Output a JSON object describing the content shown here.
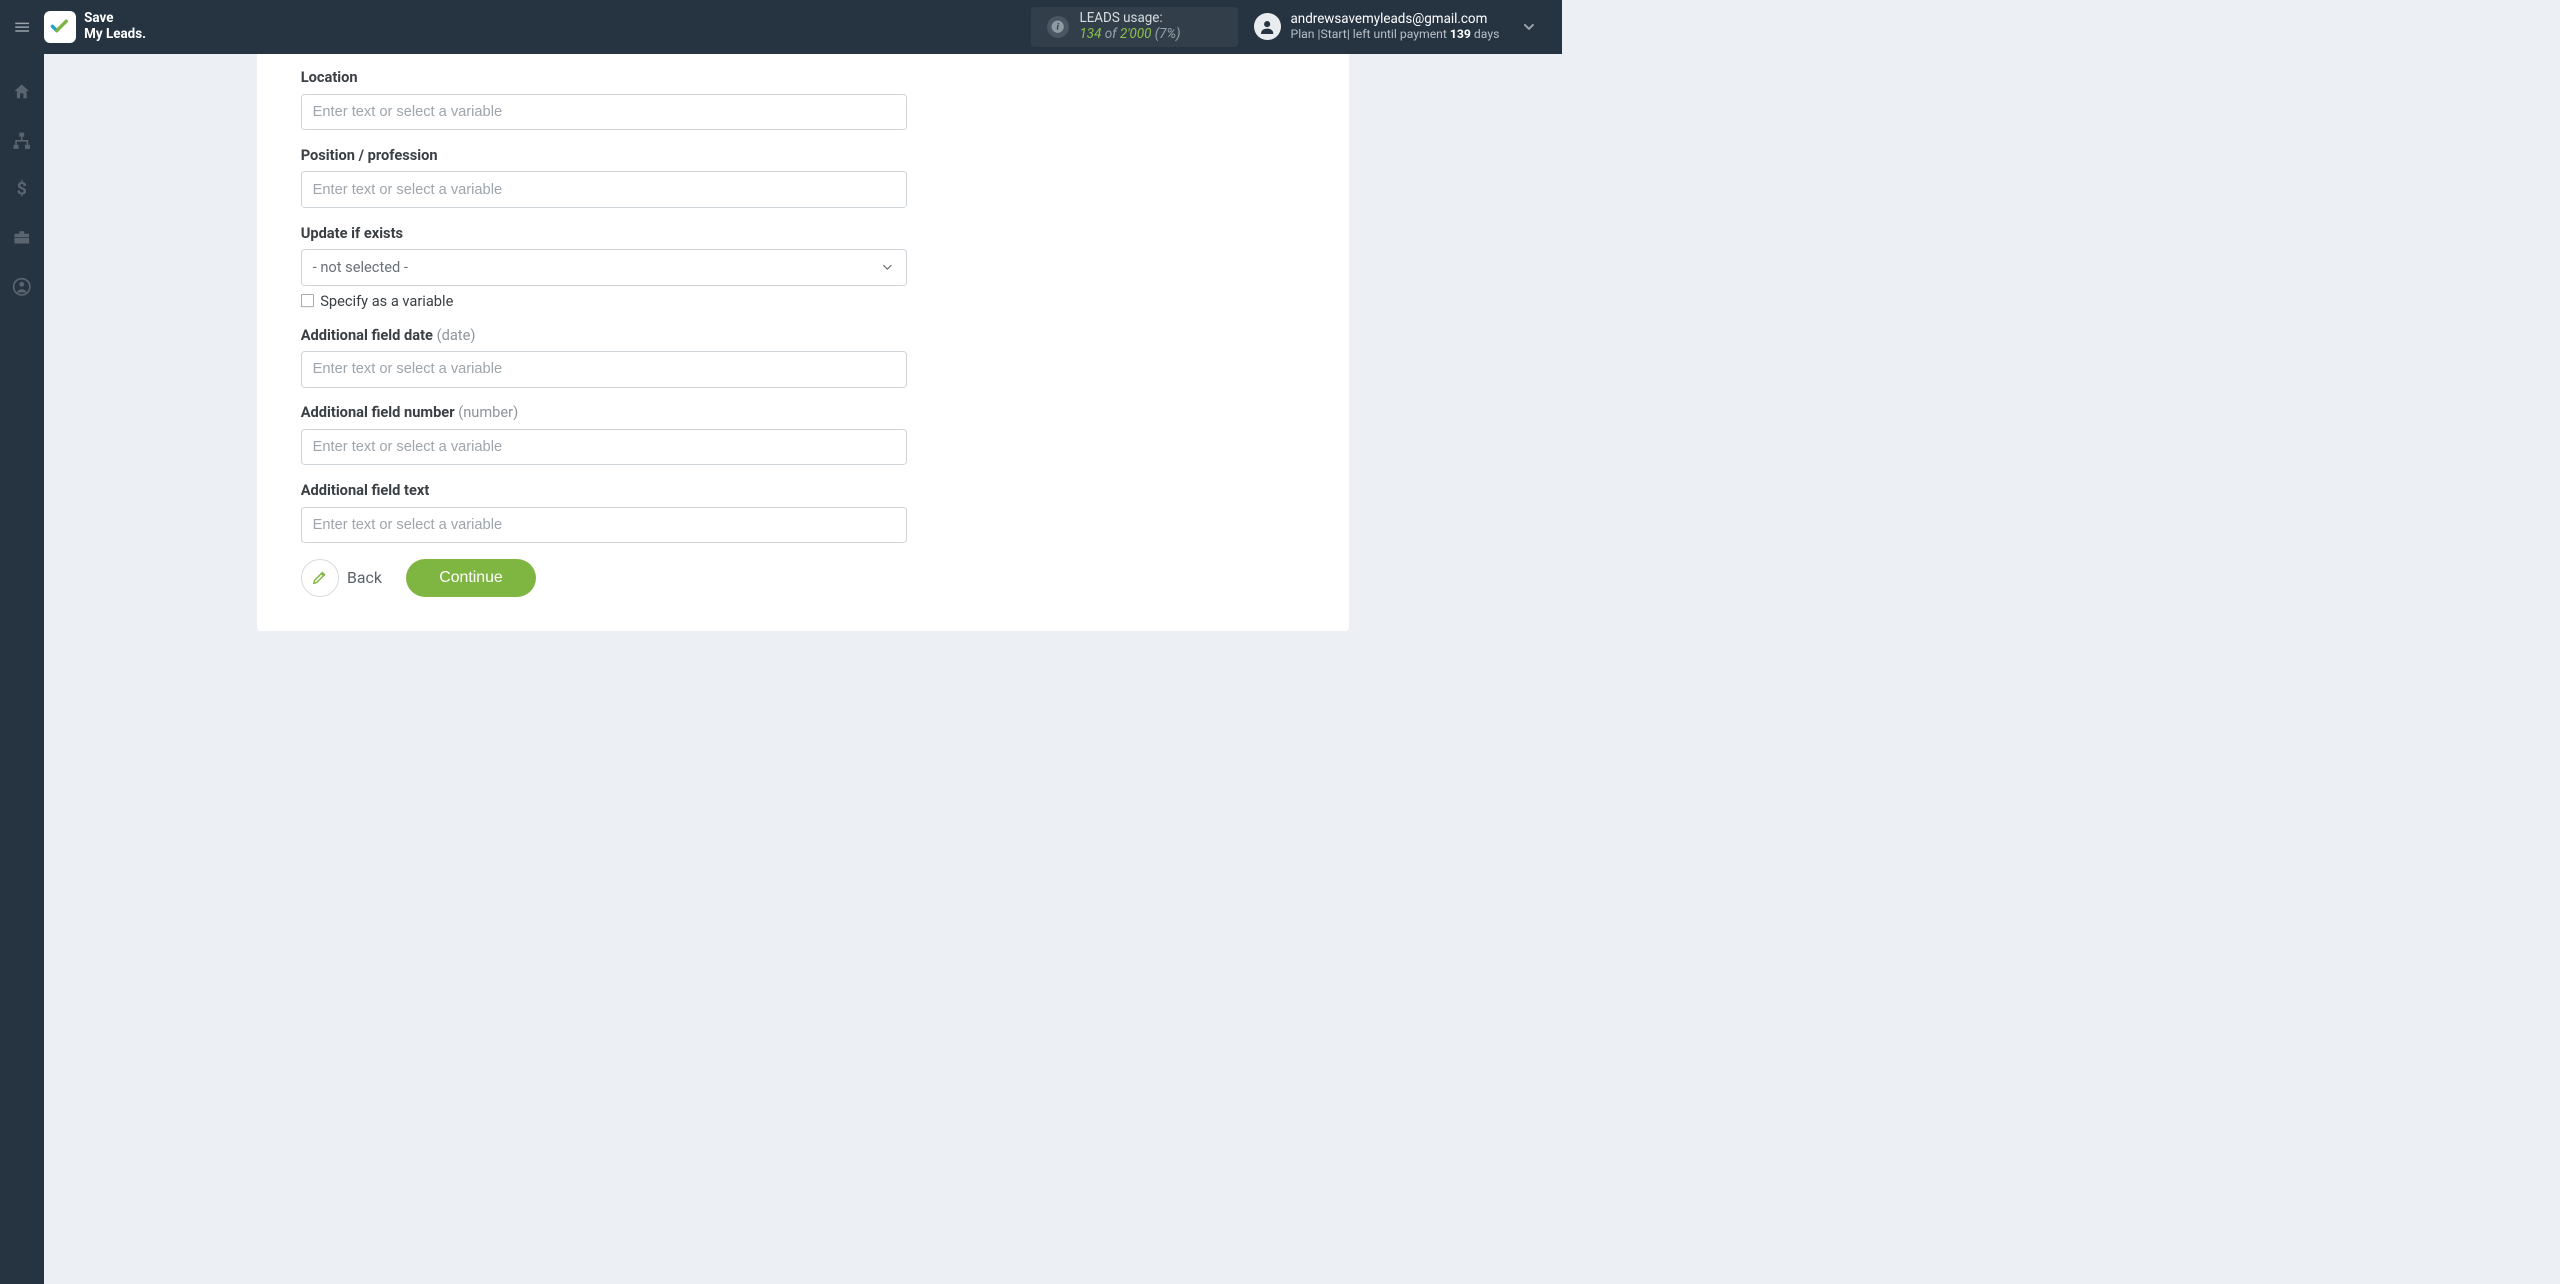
{
  "header": {
    "logo_line1": "Save",
    "logo_line2": "My Leads.",
    "usage": {
      "label": "LEADS usage:",
      "current": "134",
      "of_word": "of",
      "max": "2'000",
      "percent": "(7%)"
    },
    "account": {
      "email": "andrewsavemyleads@gmail.com",
      "plan_prefix": "Plan |",
      "plan_name": "Start",
      "plan_mid": "| left until payment ",
      "days_value": "139",
      "days_suffix": " days"
    }
  },
  "form": {
    "location": {
      "label": "Location",
      "placeholder": "Enter text or select a variable"
    },
    "position": {
      "label": "Position / profession",
      "placeholder": "Enter text or select a variable"
    },
    "update_if_exists": {
      "label": "Update if exists",
      "selected": "- not selected -"
    },
    "specify_variable": {
      "label": "Specify as a variable"
    },
    "additional_date": {
      "label": "Additional field date ",
      "hint": "(date)",
      "placeholder": "Enter text or select a variable"
    },
    "additional_number": {
      "label": "Additional field number ",
      "hint": "(number)",
      "placeholder": "Enter text or select a variable"
    },
    "additional_text": {
      "label": "Additional field text",
      "placeholder": "Enter text or select a variable"
    },
    "back_label": "Back",
    "continue_label": "Continue"
  }
}
